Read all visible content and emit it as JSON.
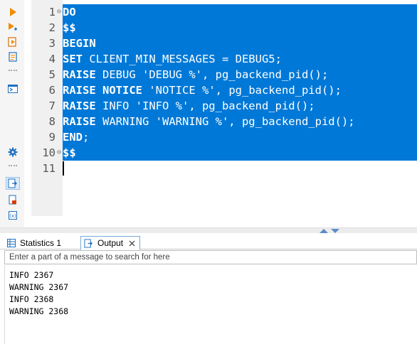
{
  "toolbar": {
    "buttons": [
      {
        "name": "execute-icon",
        "color": "#f08c00"
      },
      {
        "name": "execute-step-icon",
        "color": "#f08c00"
      },
      {
        "name": "execute-script-icon",
        "color": "#f08c00"
      },
      {
        "name": "explain-plan-icon",
        "color": "#f08c00"
      },
      {
        "name": "console-icon",
        "color": "#1f6fbf"
      },
      {
        "name": "settings-gear-icon",
        "color": "#1f6fbf"
      },
      {
        "name": "output-panel-icon",
        "color": "#1f6fbf"
      },
      {
        "name": "export-icon",
        "color": "#d83b01"
      },
      {
        "name": "variables-icon",
        "color": "#1f6fbf"
      }
    ]
  },
  "editor": {
    "lines": [
      {
        "n": "1",
        "fold": "⊖",
        "tokens": [
          {
            "t": "DO",
            "kw": true
          }
        ]
      },
      {
        "n": "2",
        "fold": "",
        "tokens": [
          {
            "t": "$$",
            "kw": true
          }
        ]
      },
      {
        "n": "3",
        "fold": "",
        "tokens": [
          {
            "t": "BEGIN",
            "kw": true
          }
        ]
      },
      {
        "n": "4",
        "fold": "",
        "tokens": [
          {
            "t": "SET",
            "kw": true
          },
          {
            "t": " CLIENT_MIN_MESSAGES = DEBUG5;",
            "kw": false
          }
        ]
      },
      {
        "n": "5",
        "fold": "",
        "tokens": [
          {
            "t": "RAISE",
            "kw": true
          },
          {
            "t": " DEBUG 'DEBUG %', pg_backend_pid();",
            "kw": false
          }
        ]
      },
      {
        "n": "6",
        "fold": "",
        "tokens": [
          {
            "t": "RAISE",
            "kw": true
          },
          {
            "t": " ",
            "kw": false
          },
          {
            "t": "NOTICE",
            "kw": true
          },
          {
            "t": " 'NOTICE %', pg_backend_pid();",
            "kw": false
          }
        ]
      },
      {
        "n": "7",
        "fold": "",
        "tokens": [
          {
            "t": "RAISE",
            "kw": true
          },
          {
            "t": " INFO 'INFO %', pg_backend_pid();",
            "kw": false
          }
        ]
      },
      {
        "n": "8",
        "fold": "",
        "tokens": [
          {
            "t": "RAISE",
            "kw": true
          },
          {
            "t": " WARNING 'WARNING %', pg_backend_pid();",
            "kw": false
          }
        ]
      },
      {
        "n": "9",
        "fold": "",
        "tokens": [
          {
            "t": "END",
            "kw": true
          },
          {
            "t": ";",
            "kw": false
          }
        ]
      },
      {
        "n": "10",
        "fold": "⊖",
        "tokens": [
          {
            "t": "$$",
            "kw": true
          }
        ]
      },
      {
        "n": "11",
        "fold": "",
        "tokens": []
      }
    ],
    "selection_color": "#0078d7",
    "scroll_left_glyph": "<"
  },
  "tabs": {
    "statistics_label": "Statistics 1",
    "output_label": "Output",
    "close_glyph": "×"
  },
  "search": {
    "placeholder": "Enter a part of a message to search for here",
    "value": ""
  },
  "output": {
    "lines": [
      "INFO 2367",
      "WARNING 2367",
      "INFO 2368",
      "WARNING 2368"
    ]
  }
}
